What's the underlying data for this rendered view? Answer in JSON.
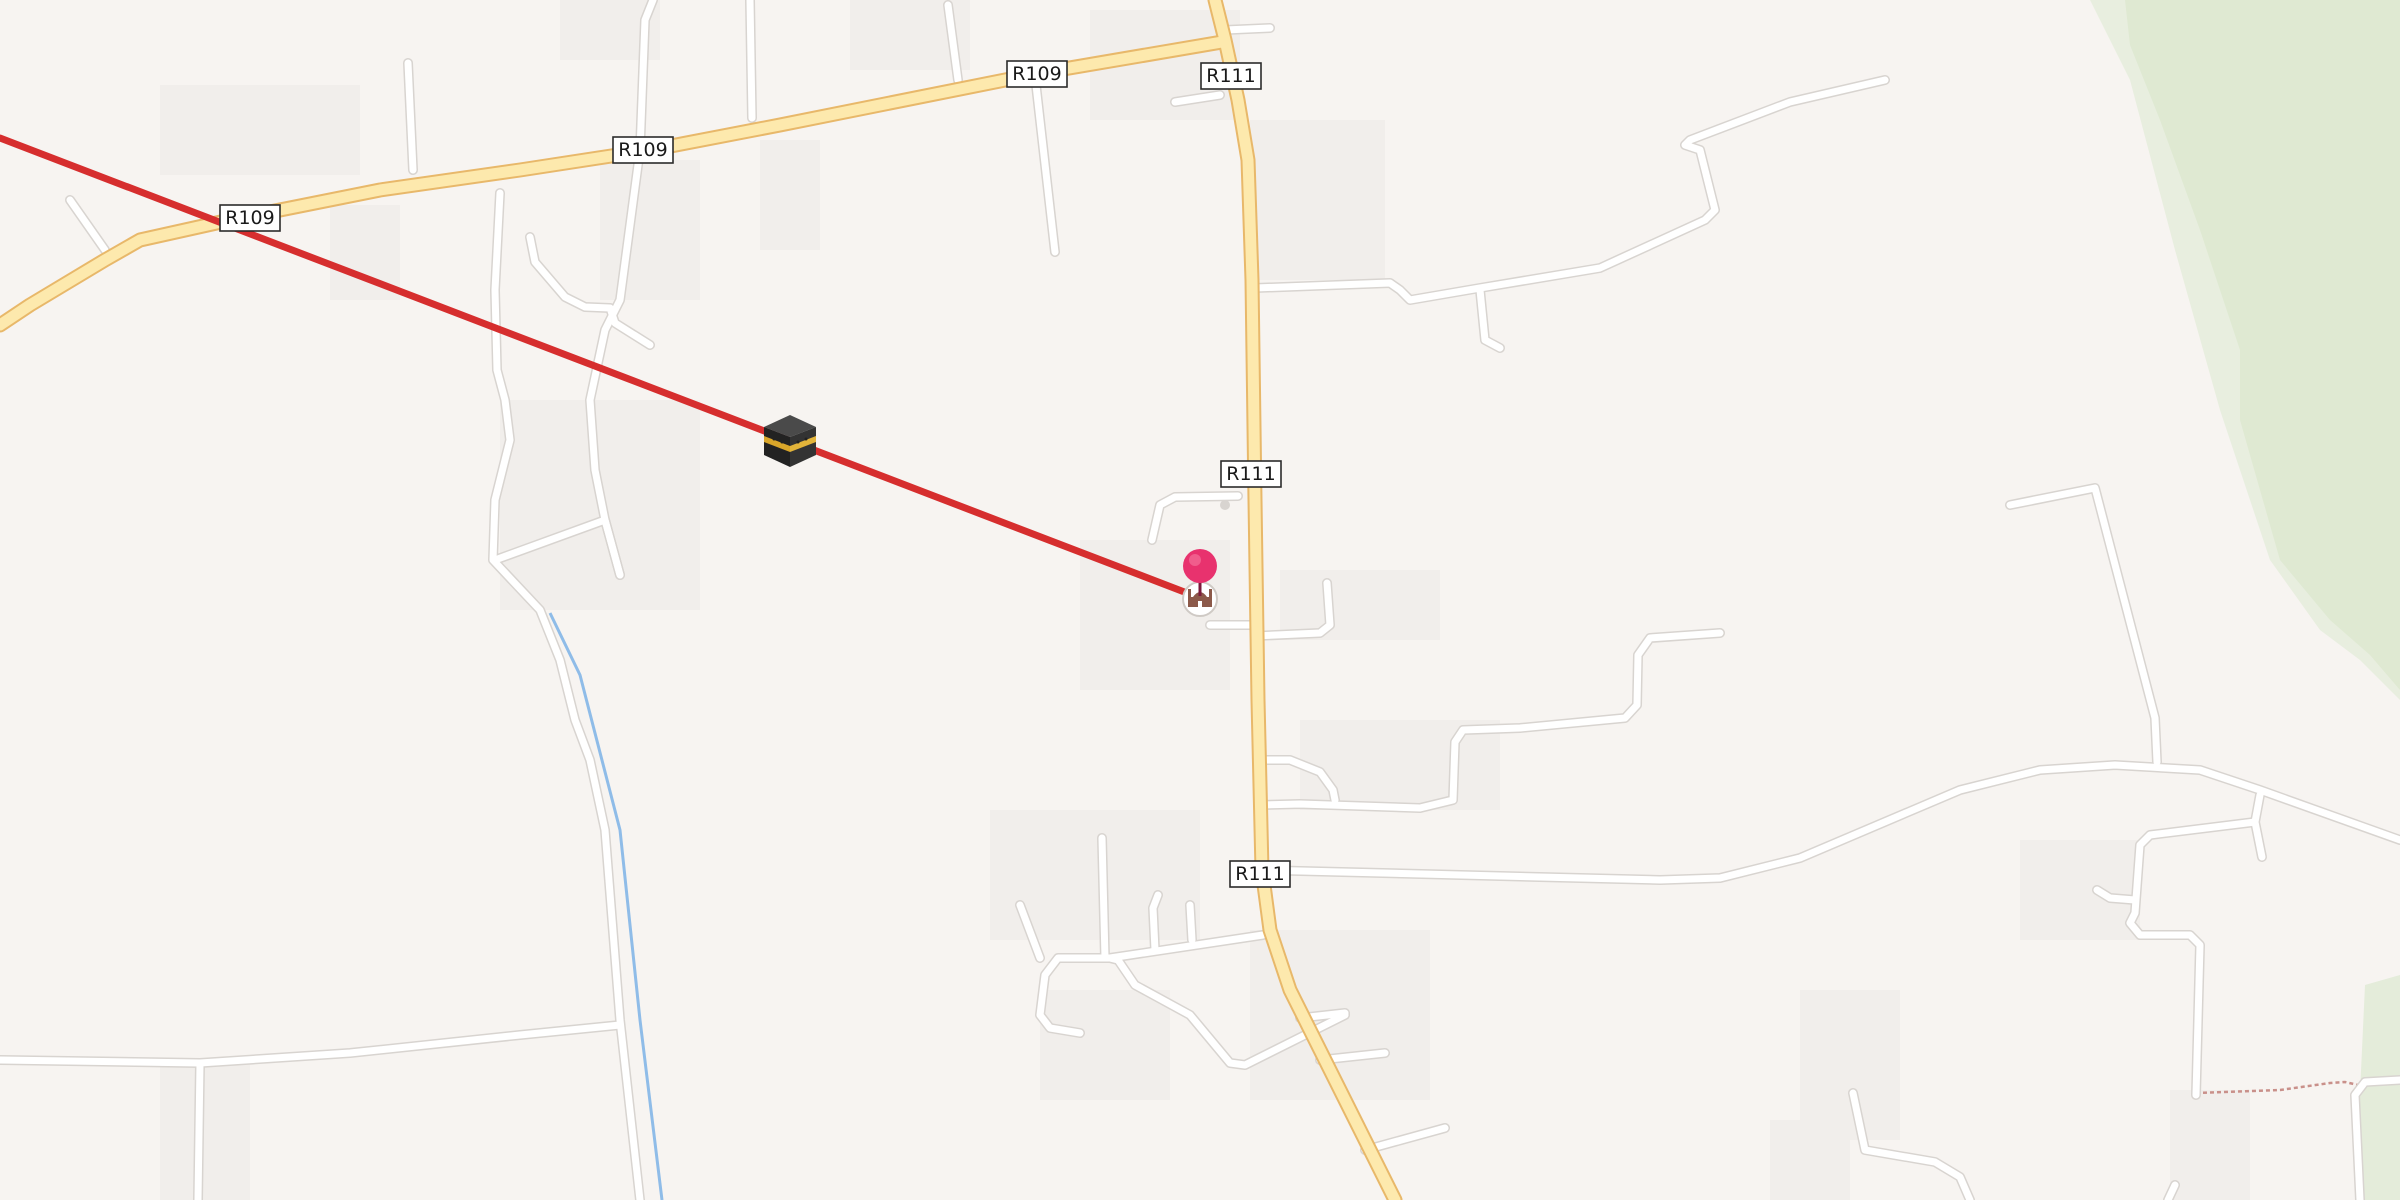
{
  "map": {
    "road_labels": [
      {
        "id": "r109-west",
        "text": "R109"
      },
      {
        "id": "r109-middle",
        "text": "R109"
      },
      {
        "id": "r109-east",
        "text": "R109"
      },
      {
        "id": "r111-north",
        "text": "R111"
      },
      {
        "id": "r111-center",
        "text": "R111"
      },
      {
        "id": "r111-south",
        "text": "R111"
      }
    ],
    "markers": {
      "kaaba": {
        "icon": "kaaba-icon"
      },
      "location_pin": {
        "icon": "map-pin-icon",
        "color": "#e8326e"
      },
      "mosque": {
        "icon": "mosque-icon"
      }
    },
    "qibla_line": {
      "color": "#d62e2e"
    },
    "colors": {
      "background": "#f7f4f1",
      "woodland": "#e1ebd6",
      "major_road": "#fde9ad",
      "major_road_casing": "#e8b86a",
      "minor_road": "#ffffff",
      "stream": "#8fbce8",
      "footpath": "#c9908a"
    }
  }
}
